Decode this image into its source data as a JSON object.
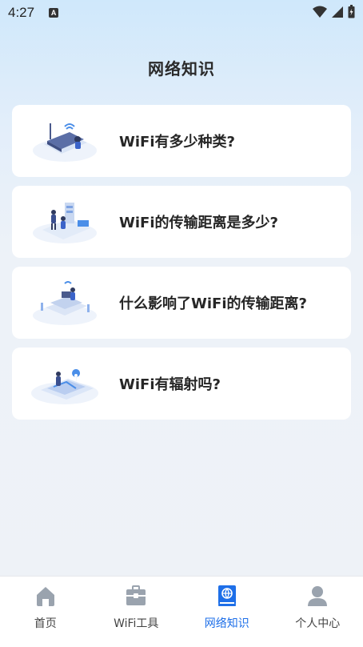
{
  "status_bar": {
    "time": "4:27",
    "notif_letter": "A"
  },
  "page": {
    "title": "网络知识"
  },
  "cards": [
    {
      "title": "WiFi有多少种类?",
      "illustration": "router-illustration"
    },
    {
      "title": "WiFi的传输距离是多少?",
      "illustration": "people-network-illustration"
    },
    {
      "title": "什么影响了WiFi的传输距离?",
      "illustration": "desk-illustration"
    },
    {
      "title": "WiFi有辐射吗?",
      "illustration": "map-pin-illustration"
    }
  ],
  "tabs": [
    {
      "label": "首页",
      "icon": "home-icon",
      "active": false
    },
    {
      "label": "WiFi工具",
      "icon": "toolbox-icon",
      "active": false
    },
    {
      "label": "网络知识",
      "icon": "book-globe-icon",
      "active": true
    },
    {
      "label": "个人中心",
      "icon": "person-icon",
      "active": false
    }
  ],
  "colors": {
    "accent": "#1e6fe8",
    "inactive_icon": "#9aa3ae"
  }
}
